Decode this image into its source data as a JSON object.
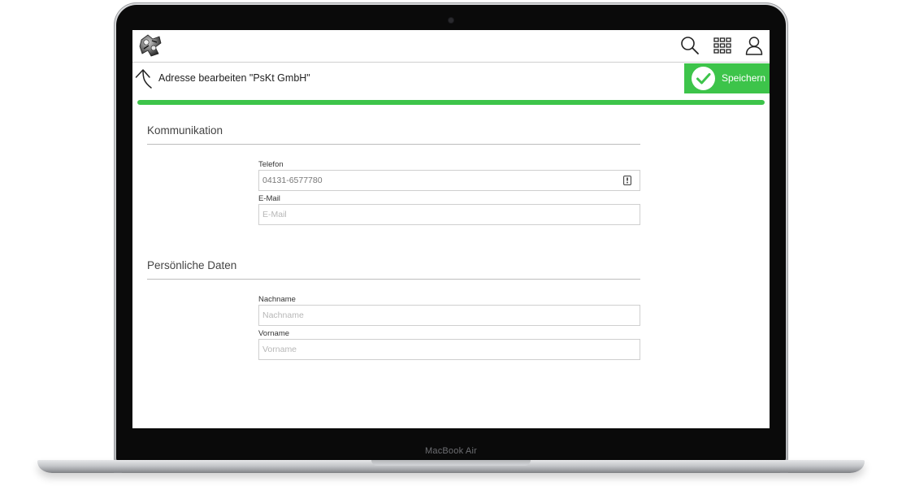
{
  "device": {
    "label": "MacBook Air"
  },
  "header": {
    "icons": [
      "app-logo-icon",
      "search-icon",
      "grid-menu-icon",
      "user-icon"
    ]
  },
  "title_bar": {
    "title": "Adresse bearbeiten \"PsKt GmbH\"",
    "save_label": "Speichern"
  },
  "progress": {
    "value_percent": 100
  },
  "sections": {
    "kommunikation": {
      "title": "Kommunikation",
      "fields": {
        "telefon": {
          "label": "Telefon",
          "value": "04131-6577780",
          "placeholder": ""
        },
        "email": {
          "label": "E-Mail",
          "value": "",
          "placeholder": "E-Mail"
        }
      }
    },
    "persoenliche_daten": {
      "title": "Persönliche Daten",
      "fields": {
        "nachname": {
          "label": "Nachname",
          "value": "",
          "placeholder": "Nachname"
        },
        "vorname": {
          "label": "Vorname",
          "value": "",
          "placeholder": "Vorname"
        }
      }
    }
  },
  "colors": {
    "accent_green": "#3dc44a",
    "bezel": "#0a0a0a",
    "border": "#cfcfcf"
  }
}
